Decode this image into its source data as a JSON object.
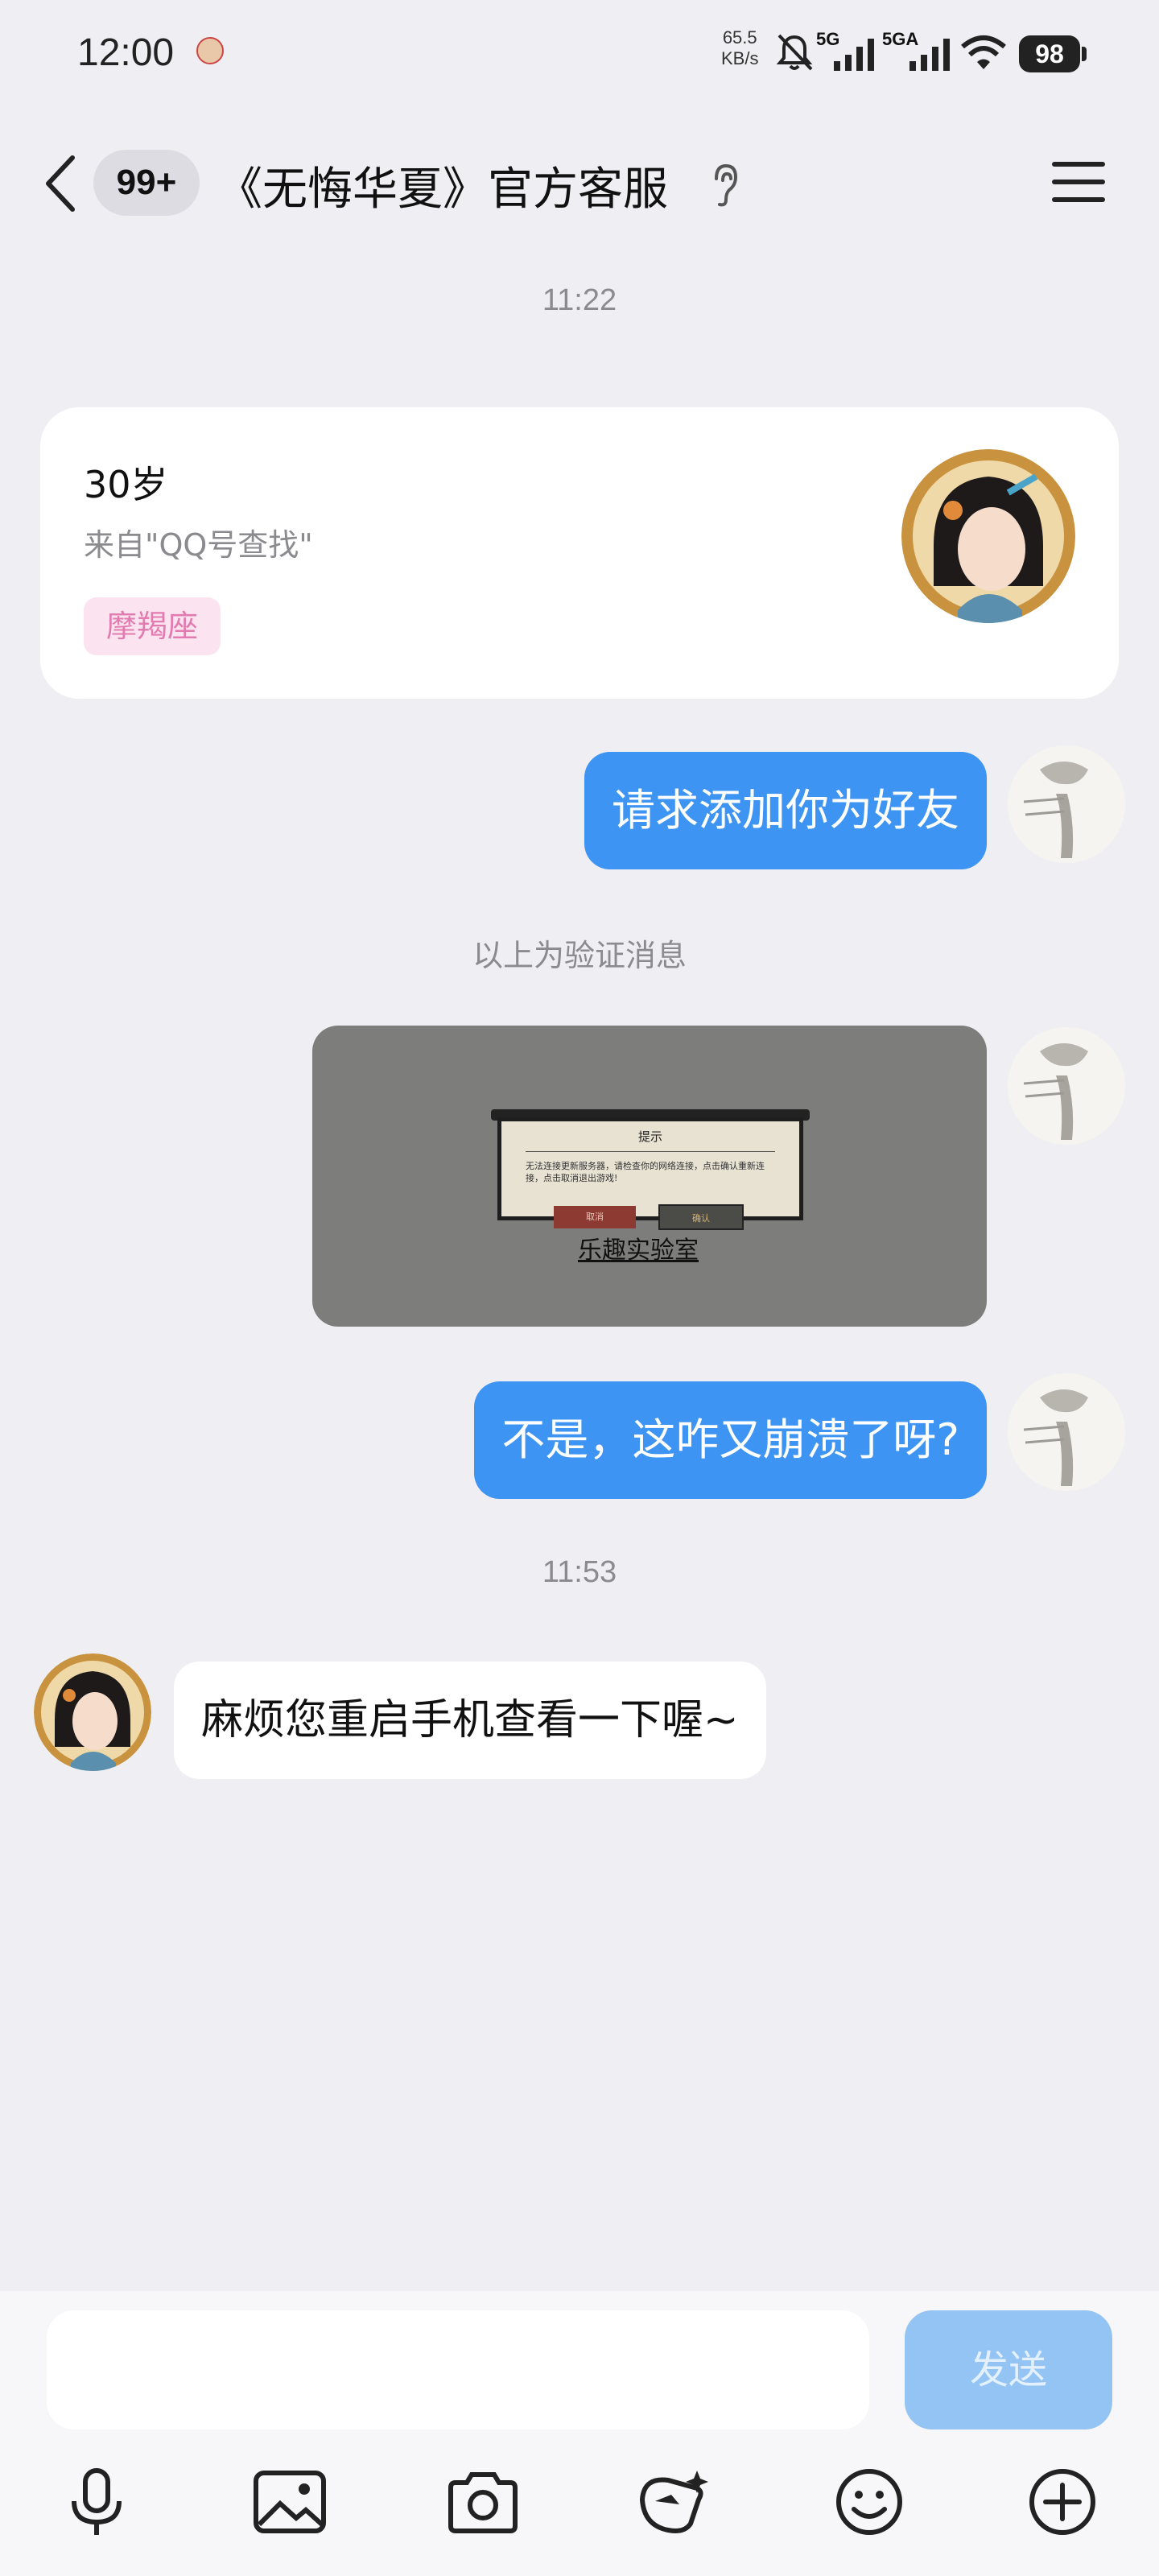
{
  "status_bar": {
    "time": "12:00",
    "net_speed_value": "65.5",
    "net_speed_unit": "KB/s",
    "signal_1_label": "5G",
    "signal_2_label": "5GA",
    "battery": "98"
  },
  "header": {
    "unread_badge": "99+",
    "title": "《无悔华夏》官方客服"
  },
  "chat": {
    "timestamp_1": "11:22",
    "profile_card": {
      "age": "30岁",
      "source": "来自\"QQ号查找\"",
      "tag": "摩羯座"
    },
    "msg_friend_request": "请求添加你为好友",
    "verify_notice": "以上为验证消息",
    "image_dialog": {
      "title": "提示",
      "body": "无法连接更新服务器，请检查你的网络连接，点击确认重新连接，点击取消退出游戏!",
      "cancel": "取消",
      "confirm": "确认",
      "studio": "乐趣实验室"
    },
    "msg_crash": "不是，这咋又崩溃了呀?",
    "timestamp_2": "11:53",
    "msg_reply": "麻烦您重启手机查看一下喔~"
  },
  "input_bar": {
    "placeholder": "",
    "send_label": "发送"
  },
  "toolbar_icons": [
    "microphone-icon",
    "image-icon",
    "camera-icon",
    "red-packet-icon",
    "emoji-icon",
    "plus-icon"
  ],
  "colors": {
    "accent": "#3e94f2",
    "send_disabled": "#94c4f4",
    "tag_bg": "#fbe3f0",
    "tag_text": "#e27bb0",
    "background": "#efeff3"
  }
}
